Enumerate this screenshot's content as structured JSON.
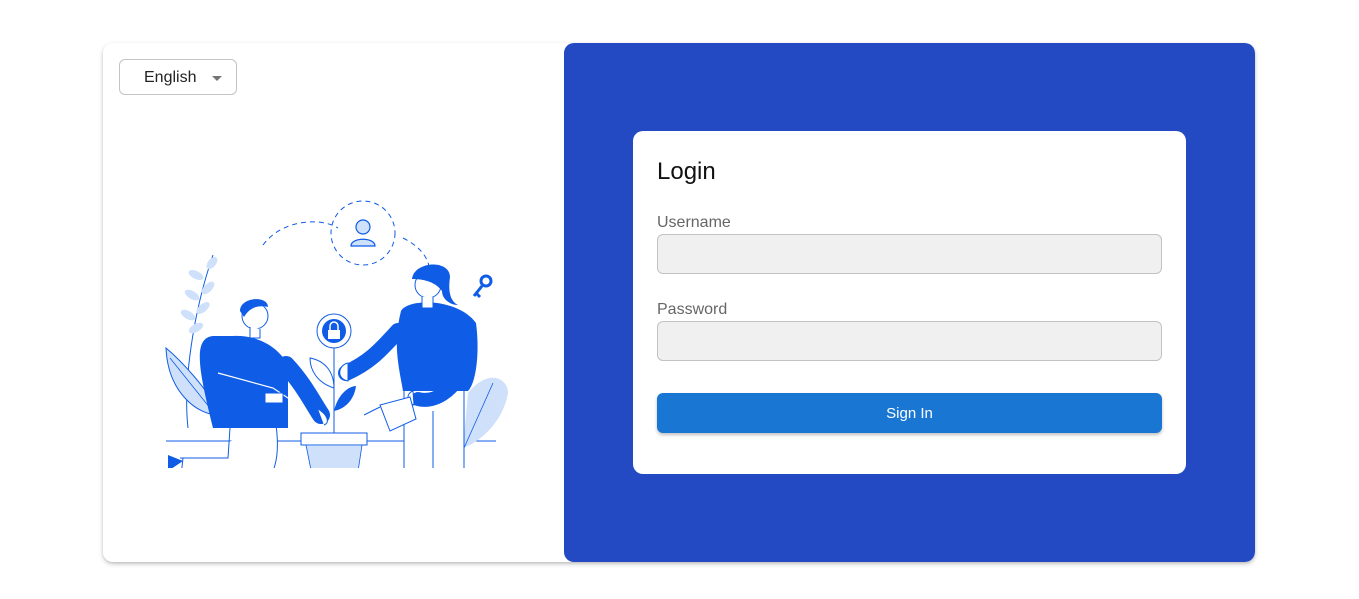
{
  "language_selector": {
    "selected": "English",
    "icon": "chevron-down-icon"
  },
  "illustration": {
    "icons": [
      "user-icon",
      "lock-icon",
      "key-icon"
    ],
    "accent_color": "#0f5ce6"
  },
  "login": {
    "title": "Login",
    "username_label": "Username",
    "username_value": "",
    "password_label": "Password",
    "password_value": "",
    "submit_label": "Sign In"
  },
  "colors": {
    "panel_bg": "#2349c3",
    "button_bg": "#1976d2",
    "input_bg": "#f0f0f0"
  }
}
